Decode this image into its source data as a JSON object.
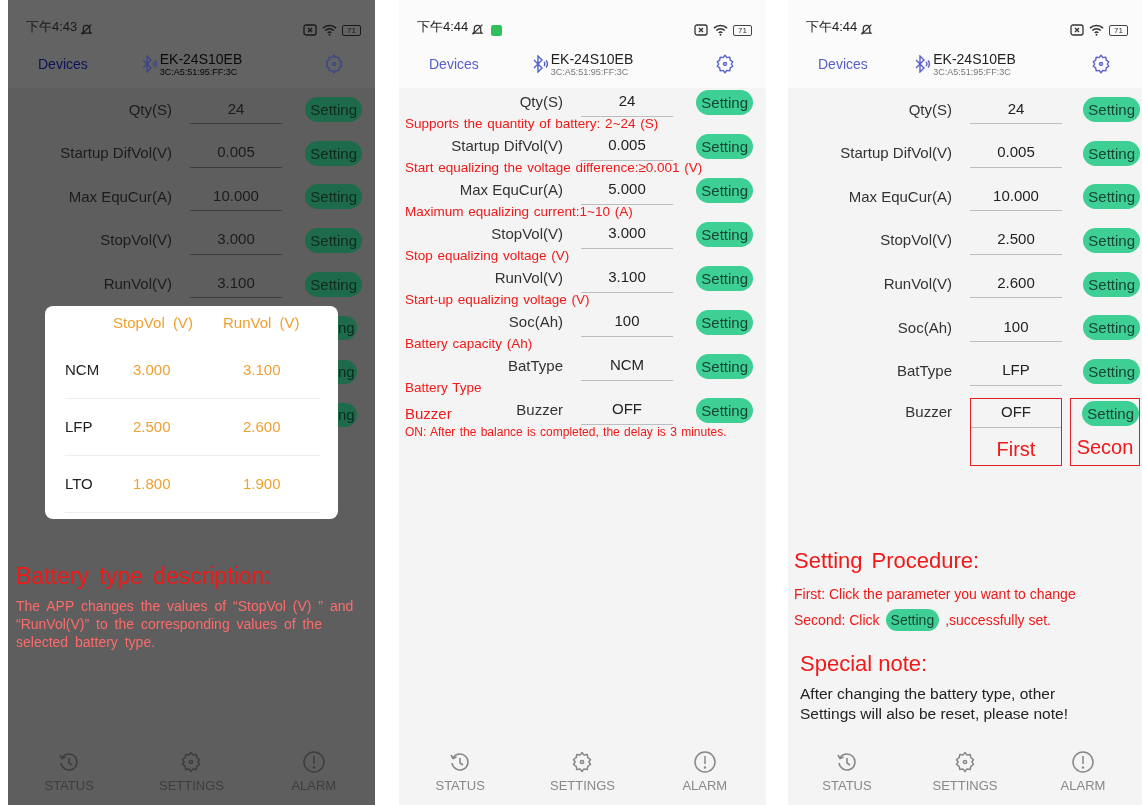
{
  "panels": [
    {
      "dimmed": true,
      "status_bar": {
        "time": "下午4:43",
        "app_notification": false,
        "battery": "71"
      },
      "header": {
        "back": "Devices",
        "device_name": "EK-24S10EB",
        "device_mac": "3C:A5:51:95:FF:3C"
      },
      "rows": [
        {
          "label": "Qty(S)",
          "value": "24",
          "button": "Setting"
        },
        {
          "label": "Startup DifVol(V)",
          "value": "0.005",
          "button": "Setting"
        },
        {
          "label": "Max EquCur(A)",
          "value": "10.000",
          "button": "Setting"
        },
        {
          "label": "StopVol(V)",
          "value": "3.000",
          "button": "Setting"
        },
        {
          "label": "RunVol(V)",
          "value": "3.100",
          "button": "Setting"
        }
      ],
      "covered_buttons": [
        "ng",
        "ng",
        "ng"
      ],
      "popup": {
        "columns": [
          "StopVol (V)",
          "RunVol (V)"
        ],
        "rows": [
          {
            "type": "NCM",
            "stop": "3.000",
            "run": "3.100"
          },
          {
            "type": "LFP",
            "stop": "2.500",
            "run": "2.600"
          },
          {
            "type": "LTO",
            "stop": "1.800",
            "run": "1.900"
          }
        ]
      },
      "description": {
        "title": "Battery type description:",
        "text": "The APP changes the values of “StopVol (V) ” and “RunVol(V)” to the corresponding values of the selected battery type."
      },
      "nav": [
        {
          "label": "STATUS",
          "kind": "history"
        },
        {
          "label": "SETTINGS",
          "kind": "gear"
        },
        {
          "label": "ALARM",
          "kind": "alert"
        }
      ]
    },
    {
      "dimmed": false,
      "status_bar": {
        "time": "下午4:44",
        "app_notification": true,
        "battery": "71"
      },
      "header": {
        "back": "Devices",
        "device_name": "EK-24S10EB",
        "device_mac": "3C:A5:51:95:FF:3C"
      },
      "rows": [
        {
          "label": "Qty(S)",
          "value": "24",
          "button": "Setting",
          "note": "Supports the quantity of battery: 2~24 (S)"
        },
        {
          "label": "Startup DifVol(V)",
          "value": "0.005",
          "button": "Setting",
          "note": "Start equalizing the voltage difference:≥0.001 (V)"
        },
        {
          "label": "Max EquCur(A)",
          "value": "5.000",
          "button": "Setting",
          "note": "Maximum equalizing current:1~10 (A)"
        },
        {
          "label": "StopVol(V)",
          "value": "3.000",
          "button": "Setting",
          "note": "Stop equalizing voltage (V)"
        },
        {
          "label": "RunVol(V)",
          "value": "3.100",
          "button": "Setting",
          "note": "Start-up equalizing voltage (V)"
        },
        {
          "label": "Soc(Ah)",
          "value": "100",
          "button": "Setting",
          "note": "Battery capacity (Ah)"
        },
        {
          "label": "BatType",
          "value": "NCM",
          "button": "Setting",
          "note": "Battery Type"
        },
        {
          "label": "Buzzer",
          "value": "OFF",
          "button": "Setting",
          "side_note": "Buzzer",
          "note": "ON: After the balance is completed, the delay is 3 minutes."
        }
      ],
      "nav": [
        {
          "label": "STATUS",
          "kind": "history"
        },
        {
          "label": "SETTINGS",
          "kind": "gear"
        },
        {
          "label": "ALARM",
          "kind": "alert"
        }
      ]
    },
    {
      "dimmed": false,
      "status_bar": {
        "time": "下午4:44",
        "app_notification": false,
        "battery": "71"
      },
      "header": {
        "back": "Devices",
        "device_name": "EK-24S10EB",
        "device_mac": "3C:A5:51:95:FF:3C"
      },
      "rows": [
        {
          "label": "Qty(S)",
          "value": "24",
          "button": "Setting"
        },
        {
          "label": "Startup DifVol(V)",
          "value": "0.005",
          "button": "Setting"
        },
        {
          "label": "Max EquCur(A)",
          "value": "10.000",
          "button": "Setting"
        },
        {
          "label": "StopVol(V)",
          "value": "2.500",
          "button": "Setting"
        },
        {
          "label": "RunVol(V)",
          "value": "2.600",
          "button": "Setting"
        },
        {
          "label": "Soc(Ah)",
          "value": "100",
          "button": "Setting"
        },
        {
          "label": "BatType",
          "value": "LFP",
          "button": "Setting"
        },
        {
          "label": "Buzzer",
          "value": "OFF",
          "button": "Setting",
          "value_callout": "First",
          "button_callout": "Secon"
        }
      ],
      "procedure": {
        "title": "Setting Procedure:",
        "first": "First: Click the parameter you want to change",
        "second_before": "Second: Click",
        "second_button": "Setting",
        "second_after": ",successfully set."
      },
      "special": {
        "title": "Special note:",
        "text": "After changing the battery type, other Settings will also be reset, please note!"
      },
      "nav": [
        {
          "label": "STATUS",
          "kind": "history"
        },
        {
          "label": "SETTINGS",
          "kind": "gear"
        },
        {
          "label": "ALARM",
          "kind": "alert"
        }
      ]
    }
  ]
}
